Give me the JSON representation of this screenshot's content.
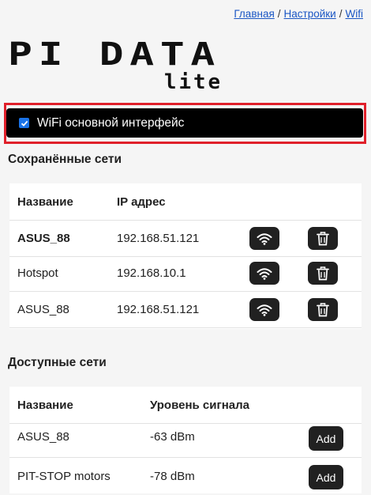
{
  "breadcrumb": {
    "items": [
      "Главная",
      "Настройки",
      "Wifi"
    ],
    "separator": "/"
  },
  "logo": {
    "line1": "PI DATA",
    "line2": "lite"
  },
  "interface": {
    "label": "WiFi основной интерфейс",
    "checked": true
  },
  "saved_networks": {
    "title": "Сохранённые сети",
    "columns": [
      "Название",
      "IP адрес"
    ],
    "rows": [
      {
        "name": "ASUS_88",
        "ip": "192.168.51.121",
        "active": true
      },
      {
        "name": "Hotspot",
        "ip": "192.168.10.1",
        "active": false
      },
      {
        "name": "ASUS_88",
        "ip": "192.168.51.121",
        "active": false
      }
    ],
    "actions": [
      "wifi-icon",
      "trash-icon"
    ]
  },
  "available_networks": {
    "title": "Доступные сети",
    "columns": [
      "Название",
      "Уровень сигнала"
    ],
    "rows": [
      {
        "name": "ASUS_88",
        "signal": "-63 dBm"
      },
      {
        "name": "PIT-STOP motors",
        "signal": "-78 dBm"
      }
    ],
    "add_label": "Add"
  },
  "colors": {
    "accent_border": "#e0202a",
    "button_bg": "#212121",
    "link": "#1a56c4"
  }
}
